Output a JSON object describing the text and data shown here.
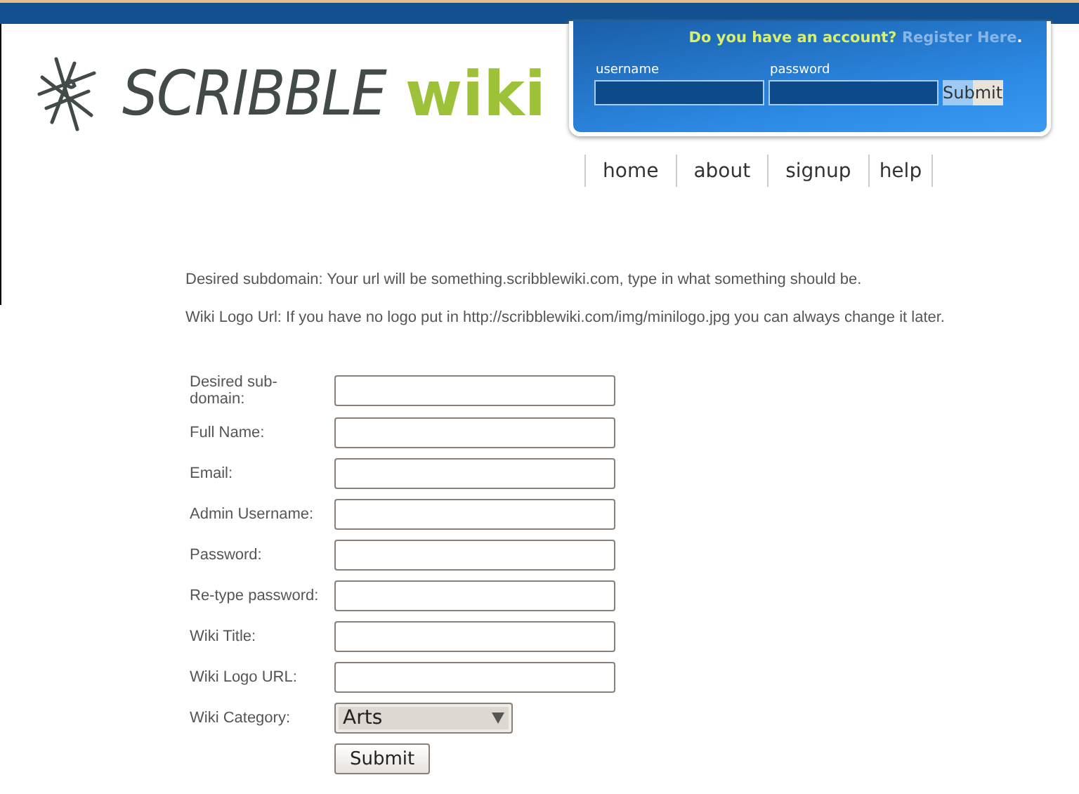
{
  "logo": {
    "mark": "SCRIBBLE",
    "suffix": "wiki"
  },
  "login": {
    "question": "Do you have an account?",
    "register_link": "Register Here",
    "period": ".",
    "username_label": "username",
    "password_label": "password",
    "submit": "Submit"
  },
  "nav": [
    "home",
    "about",
    "signup",
    "help"
  ],
  "instructions": [
    "Desired subdomain: Your url will be something.scribblewiki.com, type in what something should be.",
    "Wiki Logo Url: If you have no logo put in http://scribblewiki.com/img/minilogo.jpg you can always change it later."
  ],
  "form": [
    {
      "kind": "text",
      "label": "Desired sub-domain:"
    },
    {
      "kind": "text",
      "label": "Full Name:"
    },
    {
      "kind": "text",
      "label": "Email:"
    },
    {
      "kind": "text",
      "label": "Admin Username:"
    },
    {
      "kind": "text",
      "label": "Password:"
    },
    {
      "kind": "text",
      "label": "Re-type password:"
    },
    {
      "kind": "text",
      "label": "Wiki Title:"
    },
    {
      "kind": "text",
      "label": "Wiki Logo URL:"
    },
    {
      "kind": "select",
      "label": "Wiki Category:",
      "value": "Arts"
    }
  ],
  "submit": "Submit"
}
